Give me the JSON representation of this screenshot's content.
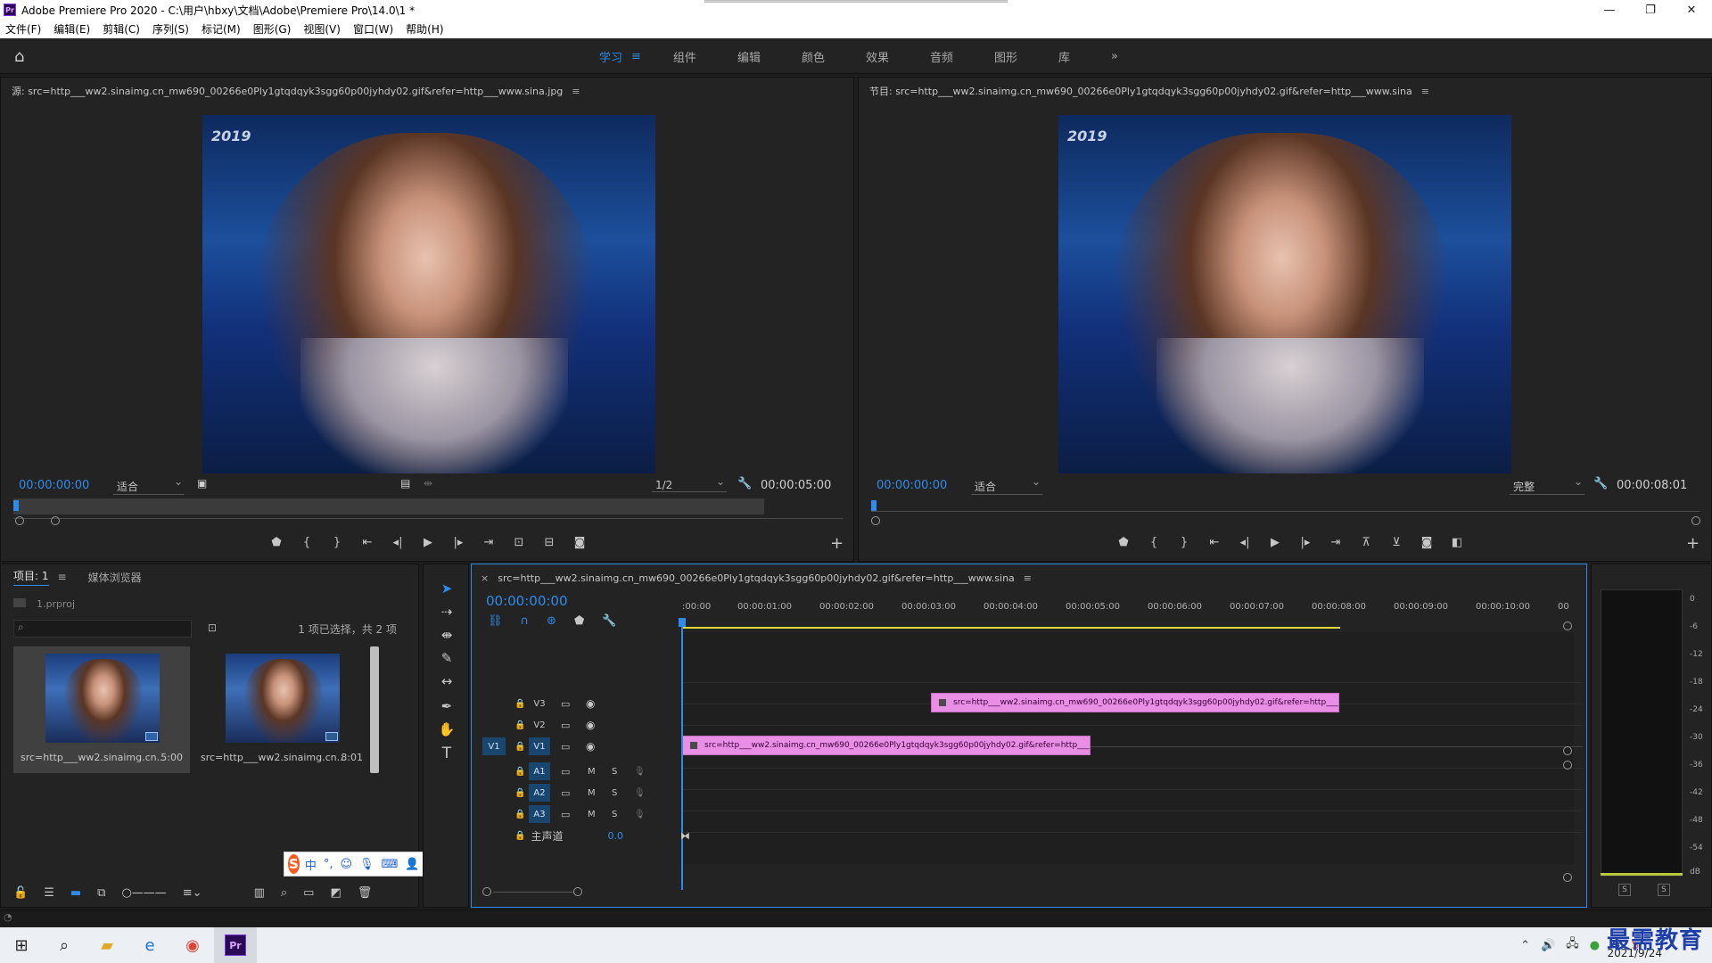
{
  "window": {
    "title": "Adobe Premiere Pro 2020 - C:\\用户\\hbxy\\文档\\Adobe\\Premiere Pro\\14.0\\1 *",
    "minimize": "—",
    "maximize": "❐",
    "close": "✕"
  },
  "menu": [
    "文件(F)",
    "编辑(E)",
    "剪辑(C)",
    "序列(S)",
    "标记(M)",
    "图形(G)",
    "视图(V)",
    "窗口(W)",
    "帮助(H)"
  ],
  "workspaces": {
    "items": [
      "学习",
      "组件",
      "编辑",
      "颜色",
      "效果",
      "音频",
      "图形",
      "库"
    ],
    "active": "学习",
    "more": "»"
  },
  "source_monitor": {
    "title": "源: src=http___ww2.sinaimg.cn_mw690_00266e0Ply1gtqdqyk3sgg60p00jyhdy02.gif&refer=http___www.sina.jpg",
    "image_text": "2019",
    "timecode": "00:00:00:00",
    "zoom": "适合",
    "resolution": "1/2",
    "duration": "00:00:05:00"
  },
  "program_monitor": {
    "title": "节目: src=http___ww2.sinaimg.cn_mw690_00266e0Ply1gtqdqyk3sgg60p00jyhdy02.gif&refer=http___www.sina",
    "image_text": "2019",
    "timecode": "00:00:00:00",
    "zoom": "适合",
    "resolution": "完整",
    "duration": "00:00:08:01"
  },
  "project": {
    "tab_label": "项目: 1",
    "media_browser_label": "媒体浏览器",
    "file": "1.prproj",
    "selection_status": "1 项已选择，共 2 项",
    "items": [
      {
        "name": "src=http___ww2.sinaimg.cn...",
        "duration": "5:00"
      },
      {
        "name": "src=http___ww2.sinaimg.cn...",
        "duration": "8:01"
      }
    ]
  },
  "ime": {
    "mode": "中",
    "punct": "°,"
  },
  "timeline": {
    "sequence_title": "src=http___ww2.sinaimg.cn_mw690_00266e0Ply1gtqdqyk3sgg60p00jyhdy02.gif&refer=http___www.sina",
    "timecode": "00:00:00:00",
    "ruler": [
      ":00:00",
      "00:00:01:00",
      "00:00:02:00",
      "00:00:03:00",
      "00:00:04:00",
      "00:00:05:00",
      "00:00:06:00",
      "00:00:07:00",
      "00:00:08:00",
      "00:00:09:00",
      "00:00:10:00",
      "00"
    ],
    "tracks": {
      "v_source": "V1",
      "video": [
        "V3",
        "V2",
        "V1"
      ],
      "audio": [
        "A1",
        "A2",
        "A3"
      ],
      "mute_label": "M",
      "solo_label": "S",
      "master_label": "主声道",
      "master_value": "0.0"
    },
    "clips": [
      {
        "track": "V3",
        "label": "src=http___ww2.sinaimg.cn_mw690_00266e0Ply1gtqdqyk3sgg60p00jyhdy02.gif&refer=http___www.sina",
        "start_sec": 3.0,
        "end_sec": 8.0
      },
      {
        "track": "V1",
        "label": "src=http___ww2.sinaimg.cn_mw690_00266e0Ply1gtqdqyk3sgg60p00jyhdy02.gif&refer=http___www.sina",
        "start_sec": 0.0,
        "end_sec": 5.0
      }
    ]
  },
  "meter": {
    "scale": [
      "0",
      "-6",
      "-12",
      "-18",
      "-24",
      "-30",
      "-36",
      "-42",
      "-48",
      "-54",
      "dB"
    ],
    "solo_left": "S",
    "solo_right": "S"
  },
  "taskbar": {
    "app_label": "Pr",
    "date": "2021/9/24",
    "watermark": "最需教育"
  }
}
